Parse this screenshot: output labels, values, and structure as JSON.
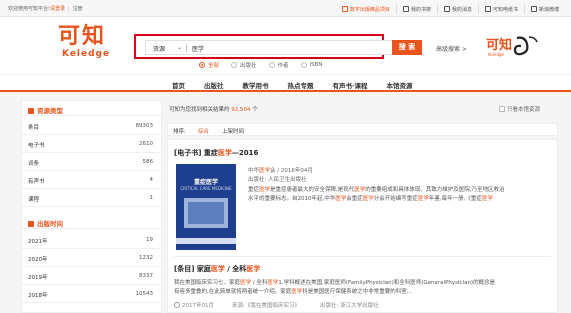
{
  "topbar": {
    "welcome": "欢迎使用可知平台!",
    "login": "请登录",
    "register": "注册",
    "nav": [
      {
        "label": "数字出版精品项目",
        "icon": "badge-icon"
      },
      {
        "label": "我的书架",
        "icon": "bookshelf-icon"
      },
      {
        "label": "我的消息",
        "icon": "message-icon"
      },
      {
        "label": "可知电纸书",
        "icon": "ebook-icon"
      },
      {
        "label": "新浪微博",
        "icon": "weibo-icon"
      }
    ]
  },
  "logo": {
    "cn": "可知",
    "en": "Keledge"
  },
  "search": {
    "type": "资源",
    "query": "医学",
    "button": "搜 索",
    "advanced": "高级搜索 >",
    "options": [
      {
        "label": "全部",
        "selected": true
      },
      {
        "label": "出版社",
        "selected": false
      },
      {
        "label": "作者",
        "selected": false
      },
      {
        "label": "ISBN",
        "selected": false
      }
    ]
  },
  "nav": [
    "首页",
    "出版社",
    "教学用书",
    "热点专题",
    "有声书·课程",
    "本馆资源"
  ],
  "sidebar": {
    "section1": {
      "title": "资源类型",
      "items": [
        {
          "label": "条目",
          "count": "89303"
        },
        {
          "label": "电子书",
          "count": "2610"
        },
        {
          "label": "词条",
          "count": "586"
        },
        {
          "label": "有声书",
          "count": "4"
        },
        {
          "label": "课程",
          "count": "1"
        }
      ]
    },
    "section2": {
      "title": "出版时间",
      "items": [
        {
          "label": "2021年",
          "count": "19"
        },
        {
          "label": "2020年",
          "count": "1232"
        },
        {
          "label": "2019年",
          "count": "8337"
        },
        {
          "label": "2018年",
          "count": "10543"
        }
      ]
    }
  },
  "results_info": {
    "prefix": "可知为您找到相关结果约",
    "count": "92,504",
    "suffix": "个"
  },
  "only_library": "只看本馆资源",
  "sort": {
    "label": "排序:",
    "options": [
      "综合",
      "上架时间"
    ],
    "active": "综合"
  },
  "result1": {
    "type": "[电子书]",
    "title_pre": "重症",
    "title_hl": "医学",
    "title_post": "—2016",
    "cover": {
      "title": "重症医学",
      "subtitle": "CRITICAL CARE MEDICINE"
    },
    "meta1_pre": "中华",
    "meta1_hl": "医学",
    "meta1_post": "会 / 2016年04月",
    "publisher": "出版社: 人民卫生出版社",
    "desc1": [
      {
        "t": "重症"
      },
      {
        "t": "医学",
        "h": true
      },
      {
        "t": "是重症患者最大的安全保障,是现代"
      },
      {
        "t": "医学",
        "h": true
      },
      {
        "t": "的重要组成和具体体现。其致力维护及医院,乃至地区救治"
      }
    ],
    "desc2": [
      {
        "t": "水平的重要标志。自2010年起,中华"
      },
      {
        "t": "医学",
        "h": true
      },
      {
        "t": "会重症"
      },
      {
        "t": "医学",
        "h": true
      },
      {
        "t": "分会开始编写重症"
      },
      {
        "t": "医学",
        "h": true
      },
      {
        "t": "年鉴,每年一册,《重症"
      },
      {
        "t": "医学",
        "h": true
      }
    ]
  },
  "result2": {
    "type": "[条目]",
    "title_pre": "家庭",
    "title_hl": "医学",
    "title_mid": " / 全科",
    "title_hl2": "医学",
    "desc1": [
      {
        "t": "我在美国临床实习七、家庭"
      },
      {
        "t": "医学",
        "h": true
      },
      {
        "t": " / 全科"
      },
      {
        "t": "医学",
        "h": true
      },
      {
        "t": "1.学科概述在美国,家庭医师(FamilyPhysician)和全科医师(GeneralPhysician)的概念是"
      }
    ],
    "desc2": [
      {
        "t": "有容多重叠的,在此简单就将两者统一介绍。家庭"
      },
      {
        "t": "医学",
        "h": true
      },
      {
        "t": "科是美国医疗保健系统之中非常重要的科室..."
      }
    ],
    "date": "2017年01月",
    "source": "来源:《我在美国临床实习》",
    "publisher": "出版社: 浙江大学出版社"
  }
}
